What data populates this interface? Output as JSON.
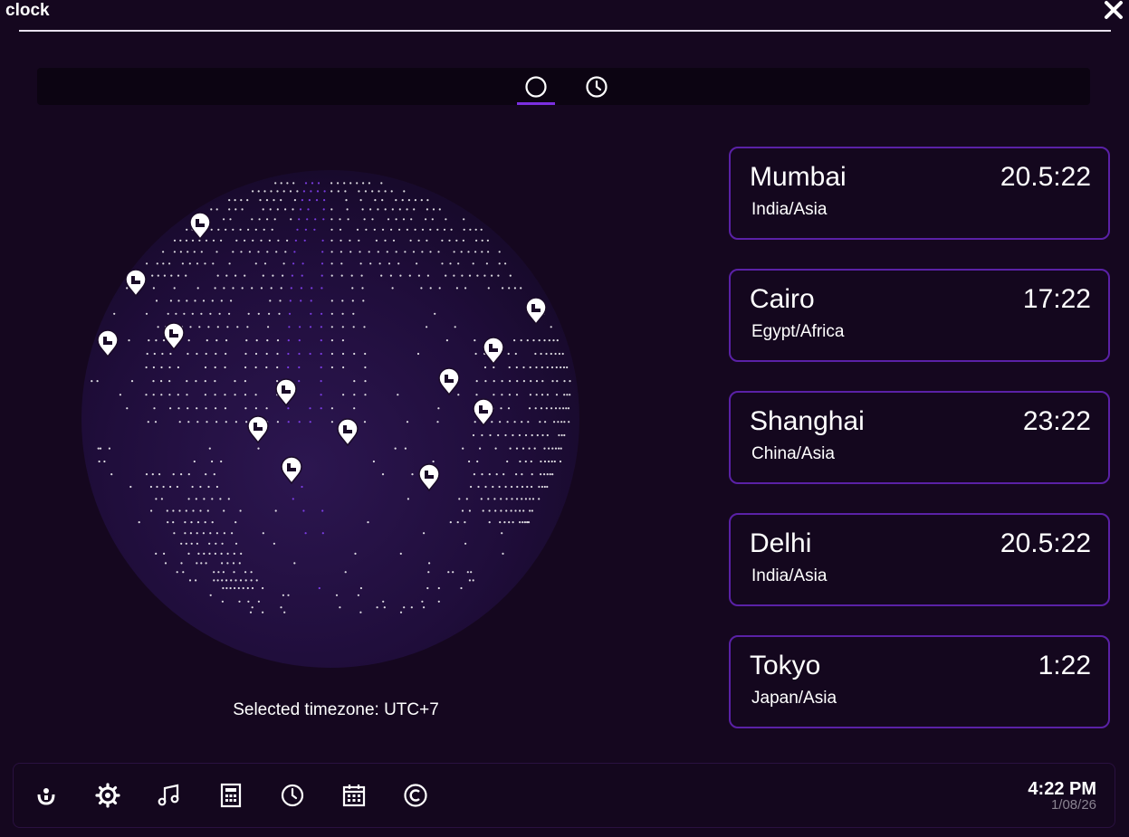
{
  "window": {
    "title": "clock"
  },
  "tabs": [
    {
      "icon": "circle-icon",
      "active": true
    },
    {
      "icon": "clock-icon",
      "active": false
    }
  ],
  "globe": {
    "selected_timezone_label": "Selected timezone: UTC+7",
    "marker_icon": "location-pin-icon"
  },
  "cities": [
    {
      "name": "Mumbai",
      "time": "20.5:22",
      "region": "India/Asia"
    },
    {
      "name": "Cairo",
      "time": "17:22",
      "region": "Egypt/Africa"
    },
    {
      "name": "Shanghai",
      "time": "23:22",
      "region": "China/Asia"
    },
    {
      "name": "Delhi",
      "time": "20.5:22",
      "region": "India/Asia"
    },
    {
      "name": "Tokyo",
      "time": "1:22",
      "region": "Japan/Asia"
    }
  ],
  "taskbar": {
    "icons": [
      "launcher-icon",
      "settings-gear-icon",
      "music-note-icon",
      "calculator-icon",
      "clock-icon",
      "calendar-icon",
      "copyright-icon"
    ],
    "time": "4:22 PM",
    "date": "1/08/26"
  },
  "colors": {
    "background": "#15071f",
    "accent": "#7b2fe0",
    "card_border": "#5a21a6"
  }
}
